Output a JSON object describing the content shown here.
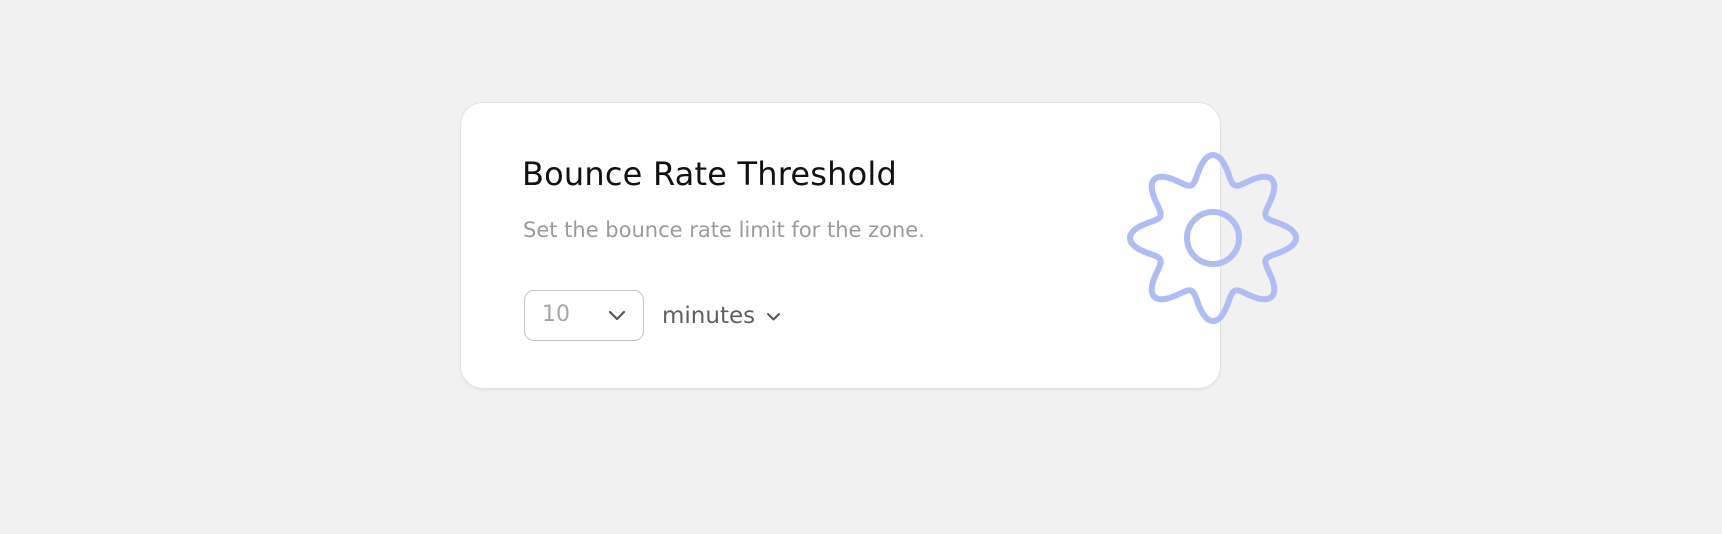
{
  "card": {
    "title": "Bounce Rate Threshold",
    "description": "Set the bounce rate limit for the zone."
  },
  "threshold": {
    "value": "10",
    "unit": "minutes"
  },
  "icons": {
    "value_dropdown": "chevron-down-icon",
    "unit_dropdown": "chevron-down-icon",
    "decoration": "gear-icon"
  },
  "colors": {
    "background": "#f1f1f1",
    "card": "#ffffff",
    "title": "#111111",
    "description": "#9b9b9b",
    "gear": "#aebdf5"
  }
}
